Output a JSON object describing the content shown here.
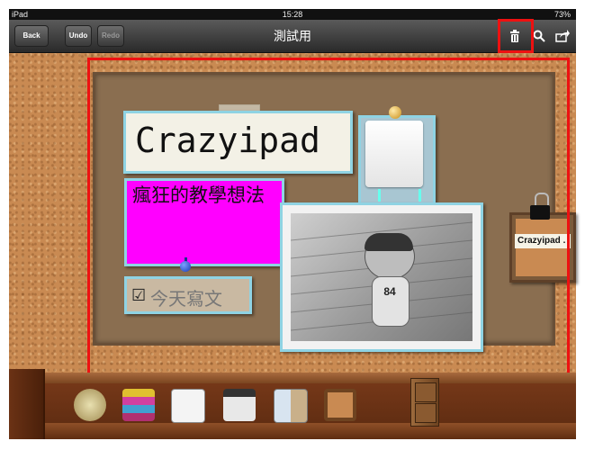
{
  "status_bar": {
    "device": "iPad",
    "time": "15:28",
    "battery": "73%"
  },
  "nav": {
    "back_label": "Back",
    "undo_label": "Undo",
    "redo_label": "Redo",
    "title": "測試用",
    "icons": [
      "trash-icon",
      "search-icon",
      "share-icon"
    ]
  },
  "board": {
    "title_card": "Crazyipad",
    "pink_note": "瘋狂的教學想法",
    "checkbox_card": {
      "box": "☑",
      "text": "今天寫文"
    },
    "photo_number": "84"
  },
  "mini_board": {
    "label": "Crazyipad ."
  },
  "shelf": {
    "icons": [
      "money-icon",
      "books-icon",
      "checklist-icon",
      "calendar-icon",
      "brochure-icon",
      "frame-icon",
      "cabinet-icon"
    ]
  },
  "colors": {
    "highlight": "#ee1111",
    "pink_note": "#ff00ff",
    "card_border": "#8fd3e3",
    "cork": "#c98a52"
  }
}
